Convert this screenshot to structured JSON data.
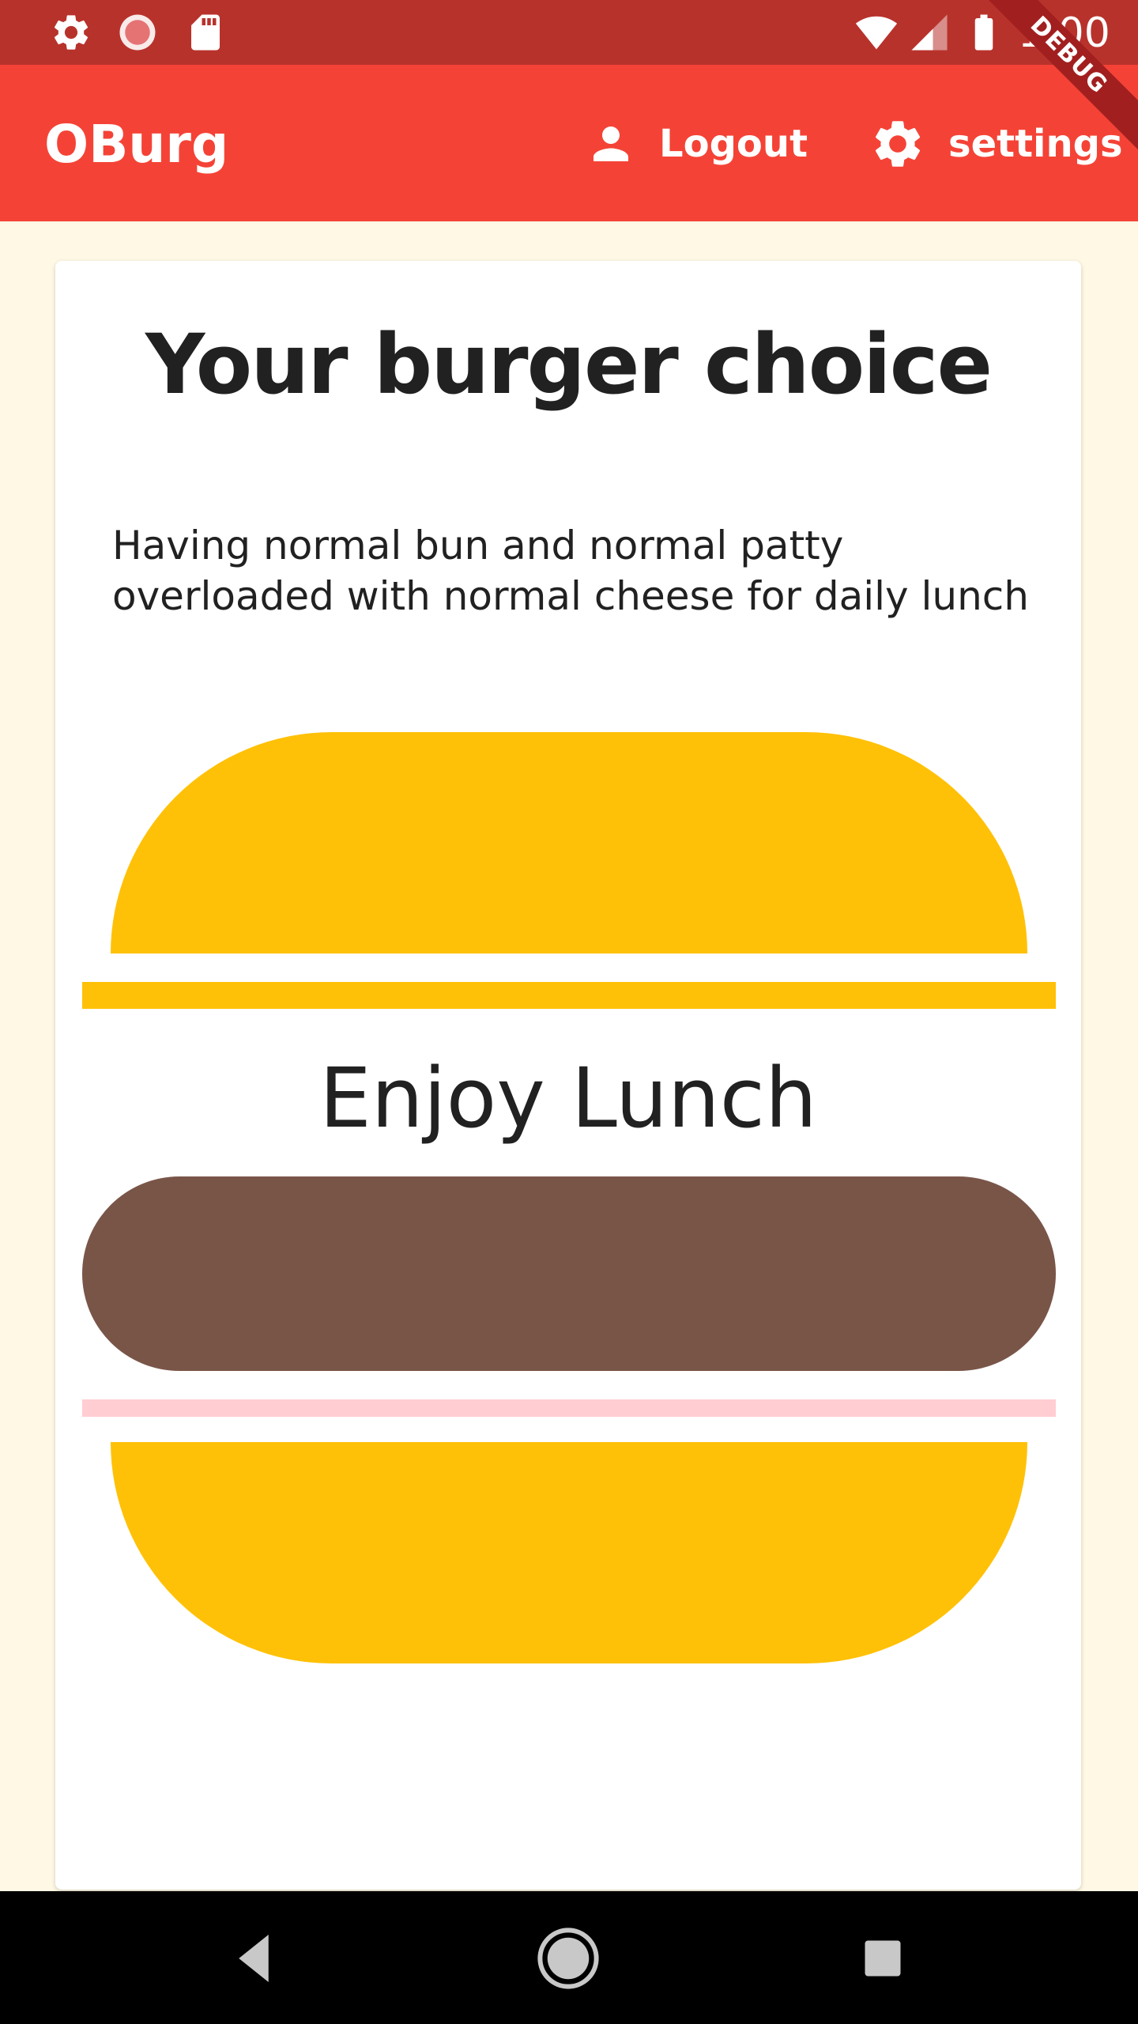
{
  "status_bar": {
    "time": "1:00",
    "debug_label": "DEBUG"
  },
  "app_bar": {
    "title": "OBurg",
    "logout_label": "Logout",
    "settings_label": "settings"
  },
  "card": {
    "title": "Your burger choice",
    "description": "Having normal bun  and normal patty overloaded with normal cheese for daily lunch",
    "enjoy_text": "Enjoy Lunch"
  },
  "colors": {
    "app_bar": "#F44336",
    "status_bar": "#B8322C",
    "bun": "#FFC107",
    "patty": "#795548",
    "cheese_line": "#FFCDD2",
    "background": "#FEF8E4"
  }
}
